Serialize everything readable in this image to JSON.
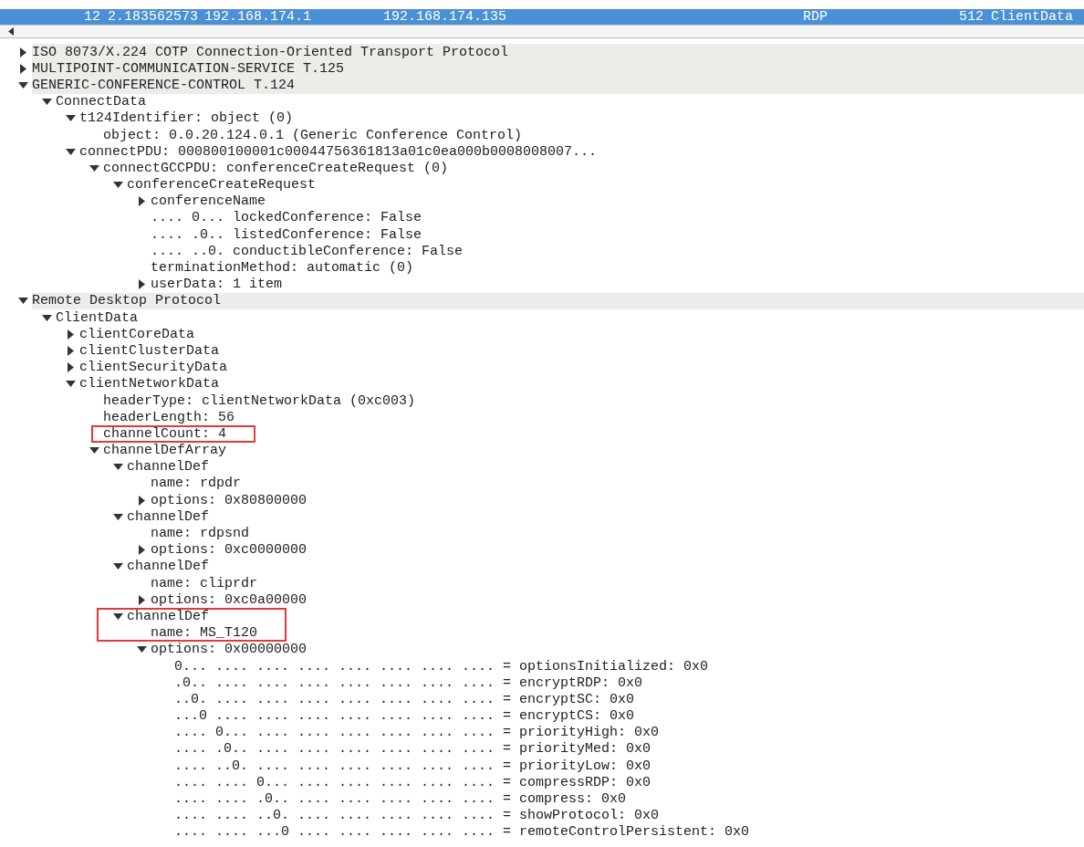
{
  "packet_list": {
    "rows": [
      {
        "selected": true,
        "cells": [
          "12",
          "2.183562573",
          "192.168.174.1",
          "192.168.174.135",
          "RDP",
          "512",
          "ClientData"
        ]
      }
    ]
  },
  "details": {
    "nodes": [
      {
        "text": "ISO 8073/X.224 COTP Connection-Oriented Transport Protocol",
        "expanded": false
      },
      {
        "text": "MULTIPOINT-COMMUNICATION-SERVICE T.125",
        "expanded": false
      },
      {
        "text": "GENERIC-CONFERENCE-CONTROL T.124",
        "expanded": true,
        "children": [
          {
            "text": "ConnectData",
            "expanded": true,
            "children": [
              {
                "text": "t124Identifier: object (0)",
                "expanded": true,
                "children": [
                  {
                    "text": "object: 0.0.20.124.0.1 (Generic Conference Control)"
                  }
                ]
              },
              {
                "text": "connectPDU: 000800100001c00044756361813a01c0ea000b0008008007...",
                "expanded": true,
                "children": [
                  {
                    "text": "connectGCCPDU: conferenceCreateRequest (0)",
                    "expanded": true,
                    "children": [
                      {
                        "text": "conferenceCreateRequest",
                        "expanded": true,
                        "children": [
                          {
                            "text": "conferenceName",
                            "expanded": false
                          },
                          {
                            "text": ".... 0... lockedConference: False"
                          },
                          {
                            "text": ".... .0.. listedConference: False"
                          },
                          {
                            "text": ".... ..0. conductibleConference: False"
                          },
                          {
                            "text": "terminationMethod: automatic (0)"
                          },
                          {
                            "text": "userData: 1 item",
                            "expanded": false
                          }
                        ]
                      }
                    ]
                  }
                ]
              }
            ]
          }
        ]
      },
      {
        "text": "Remote Desktop Protocol",
        "expanded": true,
        "children": [
          {
            "text": "ClientData",
            "expanded": true,
            "children": [
              {
                "text": "clientCoreData",
                "expanded": false
              },
              {
                "text": "clientClusterData",
                "expanded": false
              },
              {
                "text": "clientSecurityData",
                "expanded": false
              },
              {
                "text": "clientNetworkData",
                "expanded": true,
                "children": [
                  {
                    "text": "headerType: clientNetworkData (0xc003)"
                  },
                  {
                    "text": "headerLength: 56"
                  },
                  {
                    "text": "channelCount: 4",
                    "boxed": true
                  },
                  {
                    "text": "channelDefArray",
                    "expanded": true,
                    "children": [
                      {
                        "text": "channelDef",
                        "expanded": true,
                        "children": [
                          {
                            "text": "name: rdpdr"
                          },
                          {
                            "text": "options: 0x80800000",
                            "expanded": false
                          }
                        ]
                      },
                      {
                        "text": "channelDef",
                        "expanded": true,
                        "children": [
                          {
                            "text": "name: rdpsnd"
                          },
                          {
                            "text": "options: 0xc0000000",
                            "expanded": false
                          }
                        ]
                      },
                      {
                        "text": "channelDef",
                        "expanded": true,
                        "children": [
                          {
                            "text": "name: cliprdr"
                          },
                          {
                            "text": "options: 0xc0a00000",
                            "expanded": false
                          }
                        ]
                      },
                      {
                        "text": "channelDef",
                        "expanded": true,
                        "boxed": true,
                        "children": [
                          {
                            "text": "name: MS_T120",
                            "boxed": true
                          },
                          {
                            "text": "options: 0x00000000",
                            "expanded": true,
                            "children": [
                              {
                                "text": "0... .... .... .... .... .... .... .... = optionsInitialized: 0x0"
                              },
                              {
                                "text": ".0.. .... .... .... .... .... .... .... = encryptRDP: 0x0"
                              },
                              {
                                "text": "..0. .... .... .... .... .... .... .... = encryptSC: 0x0"
                              },
                              {
                                "text": "...0 .... .... .... .... .... .... .... = encryptCS: 0x0"
                              },
                              {
                                "text": ".... 0... .... .... .... .... .... .... = priorityHigh: 0x0"
                              },
                              {
                                "text": ".... .0.. .... .... .... .... .... .... = priorityMed: 0x0"
                              },
                              {
                                "text": ".... ..0. .... .... .... .... .... .... = priorityLow: 0x0"
                              },
                              {
                                "text": ".... .... 0... .... .... .... .... .... = compressRDP: 0x0"
                              },
                              {
                                "text": ".... .... .0.. .... .... .... .... .... = compress: 0x0"
                              },
                              {
                                "text": ".... .... ..0. .... .... .... .... .... = showProtocol: 0x0"
                              },
                              {
                                "text": ".... .... ...0 .... .... .... .... .... = remoteControlPersistent: 0x0"
                              }
                            ]
                          }
                        ]
                      }
                    ]
                  }
                ]
              }
            ]
          }
        ]
      }
    ]
  }
}
